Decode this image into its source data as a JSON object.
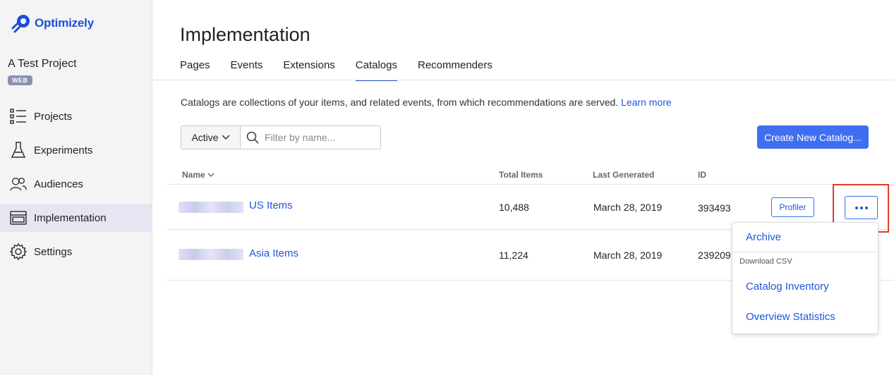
{
  "app": {
    "logo_text": "Optimizely"
  },
  "project": {
    "name": "A Test Project",
    "platform_badge": "WEB"
  },
  "sidebar": {
    "items": [
      {
        "label": "Projects",
        "icon": "list-icon",
        "active": false
      },
      {
        "label": "Experiments",
        "icon": "flask-icon",
        "active": false
      },
      {
        "label": "Audiences",
        "icon": "users-icon",
        "active": false
      },
      {
        "label": "Implementation",
        "icon": "window-icon",
        "active": true
      },
      {
        "label": "Settings",
        "icon": "gear-icon",
        "active": false
      }
    ]
  },
  "page": {
    "title": "Implementation",
    "tabs": [
      {
        "label": "Pages",
        "active": false
      },
      {
        "label": "Events",
        "active": false
      },
      {
        "label": "Extensions",
        "active": false
      },
      {
        "label": "Catalogs",
        "active": true
      },
      {
        "label": "Recommenders",
        "active": false
      }
    ],
    "description": "Catalogs are collections of your items, and related events, from which recommendations are served.",
    "learn_more": "Learn more"
  },
  "filters": {
    "status_value": "Active",
    "search_placeholder": "Filter by name..."
  },
  "create_button": "Create New Catalog...",
  "table": {
    "columns": {
      "name": "Name",
      "total_items": "Total Items",
      "last_generated": "Last Generated",
      "id": "ID"
    },
    "rows": [
      {
        "name": "US Items",
        "total_items": "10,488",
        "last_generated": "March 28, 2019",
        "id": "393493",
        "profiler": "Profiler"
      },
      {
        "name": "Asia Items",
        "total_items": "11,224",
        "last_generated": "March 28, 2019",
        "id": "239209"
      }
    ]
  },
  "dropdown": {
    "archive": "Archive",
    "section_label": "Download CSV",
    "catalog_inventory": "Catalog Inventory",
    "overview_statistics": "Overview Statistics"
  },
  "colors": {
    "accent": "#1f56d8",
    "button": "#3f6ff0",
    "highlight": "#e23a2a"
  }
}
